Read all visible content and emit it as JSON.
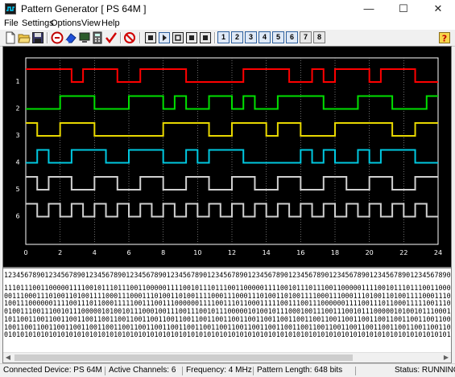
{
  "window": {
    "title": "Pattern Generator [ PS 64M ]"
  },
  "menu": [
    "File",
    "Settings",
    "Options",
    "View",
    "Help"
  ],
  "toolbar": {
    "pattern_buttons": [
      "1",
      "2",
      "3",
      "4",
      "5",
      "6",
      "7",
      "8"
    ],
    "active_patterns": [
      "1",
      "2",
      "3",
      "4",
      "5",
      "6"
    ],
    "icons": [
      "new-file-icon",
      "open-folder-icon",
      "save-icon",
      "stop-sign-icon",
      "erase-icon",
      "monitor-icon",
      "calculator-icon",
      "check-icon",
      "no-entry-icon",
      "frame-icon",
      "play-frame-icon",
      "loop-icon",
      "step-icon",
      "end-icon",
      "help-icon"
    ]
  },
  "plot": {
    "background": "#000000",
    "channels": [
      {
        "label": "1",
        "color": "#ff0000",
        "bits": "111101110011110000011110010111011100"
      },
      {
        "label": "2",
        "color": "#00e000",
        "bits": "000111000111010011010011110001110001"
      },
      {
        "label": "3",
        "color": "#e8d800",
        "bits": "100111000000111100111011000111110011"
      },
      {
        "label": "4",
        "color": "#00c8e0",
        "bits": "010011100111001011100000101001011100"
      },
      {
        "label": "5",
        "color": "#d0d0d0",
        "bits": "101100110011001100110011001100110011"
      },
      {
        "label": "6",
        "color": "#d0d0d0",
        "bits": "101010101010101010101010101010101010"
      }
    ],
    "x_ticks": [
      "0",
      "2",
      "4",
      "6",
      "8",
      "10",
      "12",
      "14",
      "16",
      "18",
      "20",
      "22",
      "24"
    ]
  },
  "text_panel": {
    "ruler": "12345678901234567890123456789012345678901234567890123456789012345678901234567890123456789012345678901234567890",
    "lines": [
      "1110111001100000111100101110111001100000111100101110111001100000111100101110111001100000111100101110111001100000",
      "0011100011101001101001111000111000111010011010011110001110001110100110100111100011100011101001101001111000111000",
      "1001110000001111001110110001111100111001110000001111001110110001111100111001110000001111001110110001111100111001",
      "0100111001110010111000001010010111000100111001110010111000001010010111000100111001110010111000001010010111000100",
      "1011001100110011001100110011001100110011001100110011001100110011001100110011001100110011001100110011001100110011",
      "1001100110011001100110011001100110011001100110011001100110011001100110011001100110011001100110011001100110011001",
      "0101010101010101010101010101010101010101010101010101010101010101010101010101010101010101010101010101010101010101"
    ]
  },
  "status": {
    "device": "Connected Device: PS 64M",
    "channels": "Active Channels: 6",
    "frequency": "Frequency: 4 MHz",
    "length": "Pattern Length: 648 bits",
    "state": "Status: RUNNING"
  }
}
